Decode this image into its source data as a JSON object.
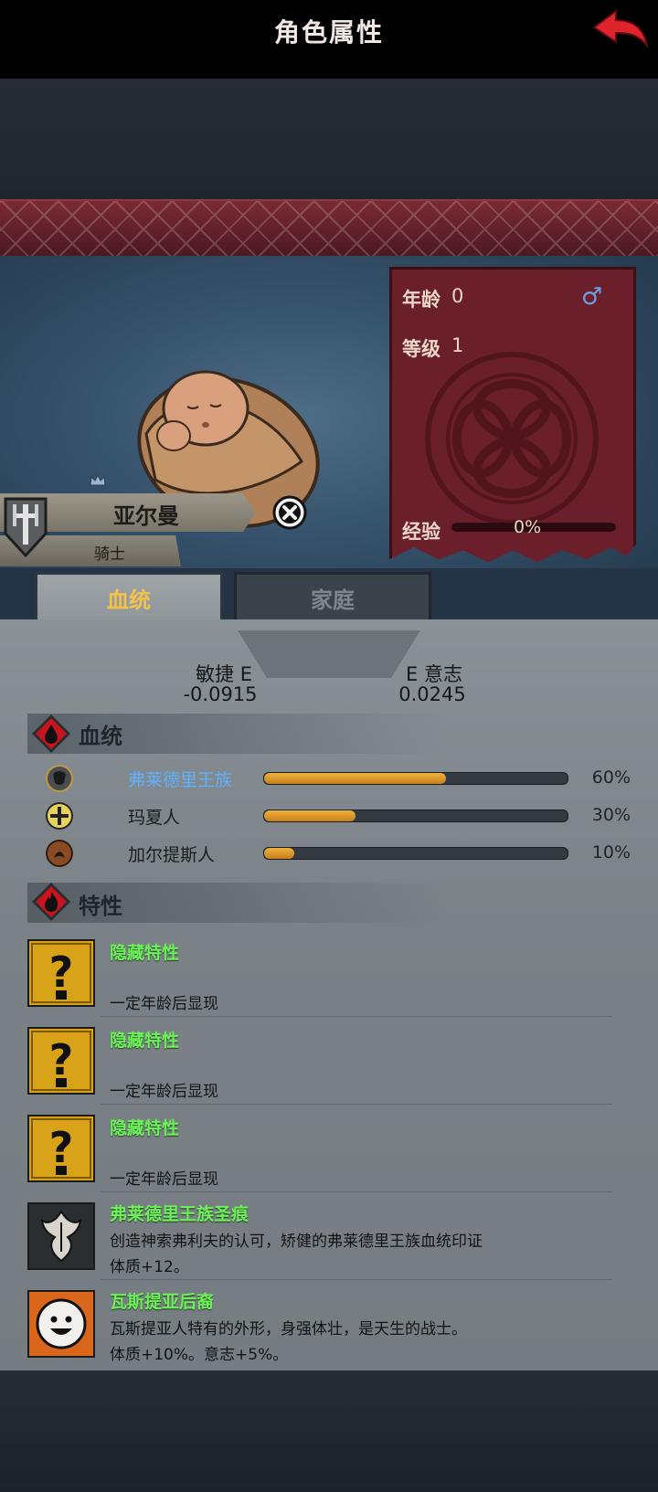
{
  "header": {
    "title": "角色属性"
  },
  "character": {
    "name": "亚尔曼",
    "rank": "骑士"
  },
  "stats": {
    "age_label": "年龄",
    "age_value": "0",
    "level_label": "等级",
    "level_value": "1",
    "exp_label": "经验",
    "exp_value": "0%",
    "exp_fraction": 0,
    "gender_symbol": "♂"
  },
  "tabs": [
    {
      "label": "血统",
      "active": true
    },
    {
      "label": "家庭",
      "active": false
    }
  ],
  "attributes": {
    "left": {
      "label": "敏捷",
      "grade": "E",
      "value": "-0.0915"
    },
    "right": {
      "label": "意志",
      "grade": "E",
      "value": "0.0245"
    }
  },
  "lineage": {
    "title": "血统",
    "rows": [
      {
        "name": "弗莱德里王族",
        "pct": "60%",
        "fraction": 0.6,
        "name_color": "#5fb0ff",
        "icon": "bull-crest-icon"
      },
      {
        "name": "玛夏人",
        "pct": "30%",
        "fraction": 0.3,
        "name_color": "#1a1c1e",
        "icon": "cross-crest-icon"
      },
      {
        "name": "加尔提斯人",
        "pct": "10%",
        "fraction": 0.1,
        "name_color": "#1a1c1e",
        "icon": "beast-crest-icon"
      }
    ]
  },
  "traits": {
    "title": "特性",
    "rows": [
      {
        "name": "隐藏特性",
        "desc1": "",
        "desc2": "一定年龄后显现",
        "icon": "question-mark-icon"
      },
      {
        "name": "隐藏特性",
        "desc1": "",
        "desc2": "一定年龄后显现",
        "icon": "question-mark-icon"
      },
      {
        "name": "隐藏特性",
        "desc1": "",
        "desc2": "一定年龄后显现",
        "icon": "question-mark-icon"
      },
      {
        "name": "弗莱德里王族圣痕",
        "desc1": "创造神索弗利夫的认可，矫健的弗莱德里王族血统印证",
        "desc2": "体质+12。",
        "icon": "royal-stigma-icon"
      },
      {
        "name": "瓦斯提亚后裔",
        "desc1": "瓦斯提亚人特有的外形，身强体壮，是天生的战士。",
        "desc2": "体质+10%。意志+5%。",
        "icon": "smiley-face-icon"
      }
    ]
  },
  "colors": {
    "accent_gold": "#f4c24a",
    "trait_green": "#6df05a",
    "banner_red": "#6b1f2a"
  }
}
